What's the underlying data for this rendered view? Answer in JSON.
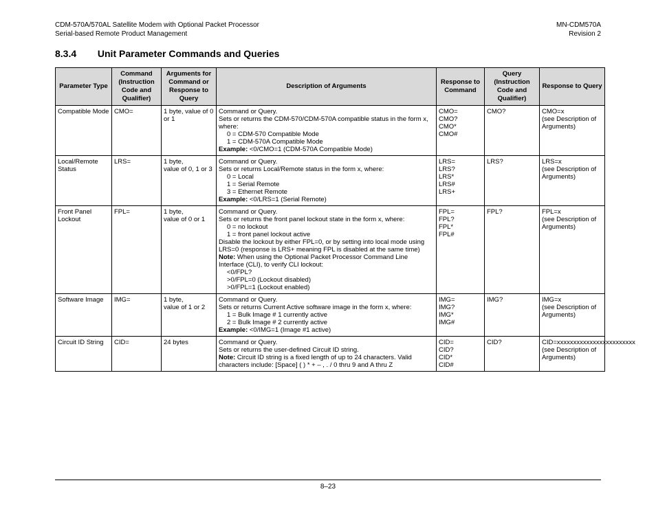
{
  "header": {
    "left": "CDM-570A/570AL Satellite Modem with Optional Packet Processor\nSerial-based Remote Product Management",
    "right": "MN-CDM570A\nRevision 2"
  },
  "section": {
    "number": "8.3.4",
    "title": "Unit Parameter Commands and Queries"
  },
  "table": {
    "headers": {
      "c1": "Parameter Type",
      "c2": "Command (Instruction Code and Qualifier)",
      "c3": "Arguments for Command or Response to Query",
      "c4": "Description of Arguments",
      "c5": "Response to Command",
      "c6": "Query (Instruction Code and Qualifier)",
      "c7": "Response to Query"
    },
    "rows": [
      {
        "param": "Compatible Mode",
        "cmd": "CMO=",
        "args": "1 byte, value of 0 or 1",
        "desc": [
          {
            "t": "Command or Query."
          },
          {
            "t": "Sets or returns the CDM-570/CDM-570A compatible status in the form x, where:"
          },
          {
            "t": "0 = CDM-570 Compatible Mode",
            "i": true
          },
          {
            "t": "1 = CDM-570A Compatible Mode",
            "i": true
          },
          {
            "b": "Example:",
            "t": " <0/CMO=1 (CDM-570A Compatible Mode)"
          }
        ],
        "resp_cmd": "CMO=\nCMO?\nCMO*\nCMO#",
        "query": "CMO?",
        "resp_q": "CMO=x\n(see Description of Arguments)"
      },
      {
        "param": "Local/Remote Status",
        "cmd": "LRS=",
        "args": "1 byte,\nvalue of 0, 1 or 3",
        "desc": [
          {
            "t": "Command or Query."
          },
          {
            "t": "Sets or returns Local/Remote status in the form x, where:"
          },
          {
            "t": "0 = Local",
            "i": true
          },
          {
            "t": "1 = Serial Remote",
            "i": true
          },
          {
            "t": "3 = Ethernet Remote",
            "i": true
          },
          {
            "b": "Example:",
            "t": " <0/LRS=1 (Serial Remote)"
          }
        ],
        "resp_cmd": "LRS=\nLRS?\nLRS*\nLRS#\nLRS+",
        "query": "LRS?",
        "resp_q": "LRS=x\n(see Description of Arguments)"
      },
      {
        "param": "Front Panel Lockout",
        "cmd": "FPL=",
        "args": "1 byte,\nvalue of 0 or 1",
        "desc": [
          {
            "t": "Command or Query."
          },
          {
            "t": "Sets or returns the front panel lockout state in the form x, where:"
          },
          {
            "t": "0 = no lockout",
            "i": true
          },
          {
            "t": "1 = front panel lockout active",
            "i": true
          },
          {
            "t": "Disable the lockout by either FPL=0, or by setting into local mode using LRS=0 (response is LRS+ meaning FPL is disabled at the same time)"
          },
          {
            "b": "Note:",
            "t": " When using the Optional Packet Processor Command Line Interface (CLI), to verify CLI lockout:"
          },
          {
            "t": "<0/FPL?",
            "i": true
          },
          {
            "t": ">0/FPL=0 (Lockout disabled)",
            "i": true
          },
          {
            "t": ">0/FPL=1 (Lockout enabled)",
            "i": true
          }
        ],
        "resp_cmd": "FPL=\nFPL?\nFPL*\nFPL#",
        "query": "FPL?",
        "resp_q": "FPL=x\n(see Description of Arguments)"
      },
      {
        "param": "Software Image",
        "cmd": "IMG=",
        "args": "1 byte,\nvalue of 1 or 2",
        "desc": [
          {
            "t": "Command or Query."
          },
          {
            "t": "Sets or returns Current Active software image in the form x, where:"
          },
          {
            "t": "1 = Bulk Image # 1 currently active",
            "i": true
          },
          {
            "t": "2 = Bulk Image # 2 currently active",
            "i": true
          },
          {
            "b": "Example:",
            "t": " <0/IMG=1 (Image #1 active)"
          }
        ],
        "resp_cmd": "IMG=\nIMG?\nIMG*\nIMG#",
        "query": "IMG?",
        "resp_q": "IMG=x\n(see Description of Arguments)"
      },
      {
        "param": "Circuit ID String",
        "cmd": "CID=",
        "args": "24 bytes",
        "desc": [
          {
            "t": "Command or Query."
          },
          {
            "t": "Sets or returns the user-defined Circuit ID string."
          },
          {
            "b": "Note:",
            "t": " Circuit ID string is a fixed length of up to 24 characters. Valid characters include: [Space] ( ) * + – , . / 0 thru  9 and A thru Z"
          }
        ],
        "resp_cmd": "CID=\nCID?\nCID*\nCID#",
        "query": "CID?",
        "resp_q": "CID=xxxxxxxxxxxxxxxxxxxxxxxx\n(see Description of Arguments)"
      }
    ]
  },
  "footer": {
    "page": "8–23"
  }
}
